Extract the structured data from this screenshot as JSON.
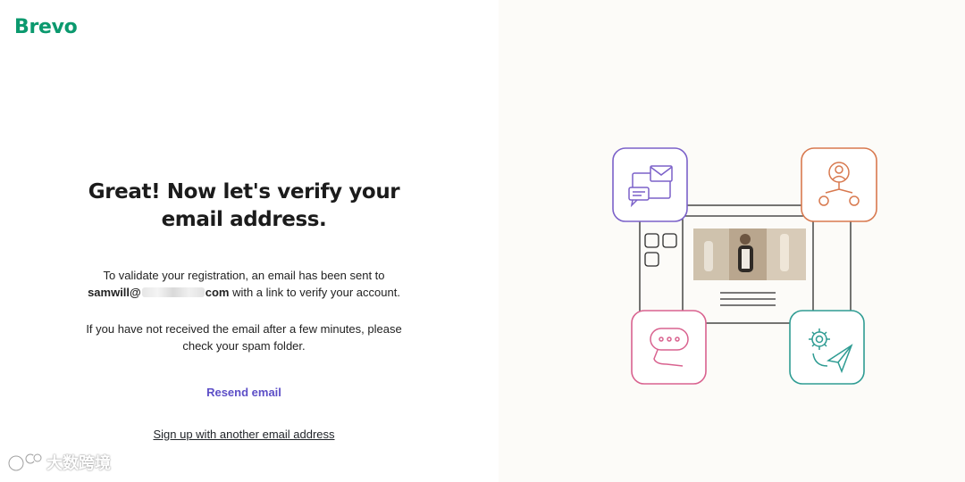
{
  "brand": {
    "logo_text": "Brevo",
    "color": "#0b996e"
  },
  "main": {
    "headline": "Great! Now let's verify your email address.",
    "para1_prefix": "To validate your registration, an email has been sent to",
    "email_start": "samwill@",
    "email_end": "com",
    "para1_suffix": "with a link to verify your account.",
    "para2": "If you have not received the email after a few minutes, please check your spam folder.",
    "resend_label": "Resend email",
    "signup_label": "Sign up with another email address"
  },
  "watermark": {
    "text": "大数跨境"
  },
  "illustration": {
    "icons": [
      "mail-chat-icon",
      "user-network-icon",
      "chat-bubble-icon",
      "gear-send-icon"
    ],
    "colors": {
      "purple": "#7b61c9",
      "orange": "#d8794f",
      "pink": "#d9628f",
      "teal": "#2f9c93"
    }
  }
}
